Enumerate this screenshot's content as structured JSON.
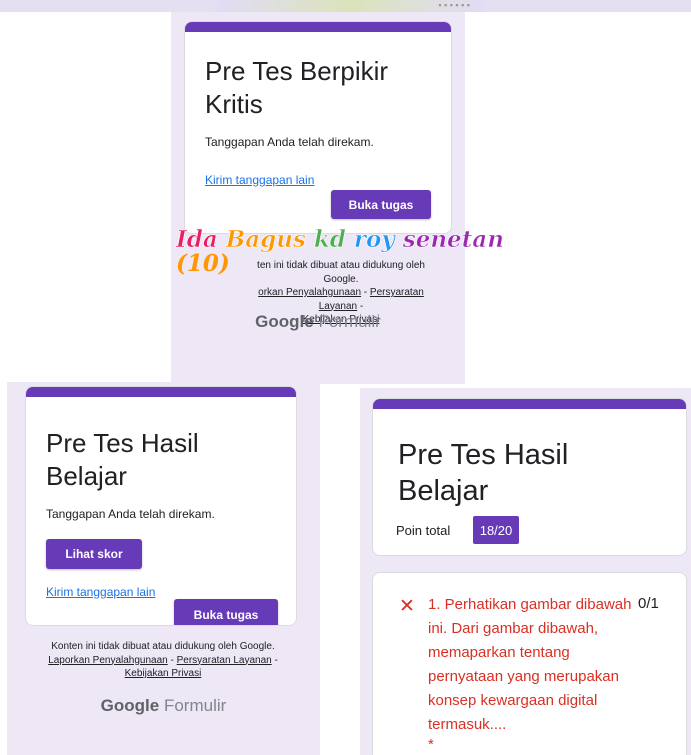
{
  "screens": [
    {
      "title": "Pre Tes Berpikir Kritis",
      "confirmation": "Tanggapan Anda telah direkam.",
      "submit_another_link": "Kirim tanggapan lain",
      "open_task_button": "Buka tugas",
      "footer": {
        "disclaimer_partial": "ten ini tidak dibuat atau didukung oleh Google.",
        "report_abuse_partial": "orkan Penyalahgunaan",
        "terms": "Persyaratan Layanan",
        "privacy": "Kebijakan Privasi"
      },
      "brand": {
        "google": "Google",
        "formulir": "Formulir"
      }
    },
    {
      "title": "Pre Tes Hasil Belajar",
      "confirmation": "Tanggapan Anda telah direkam.",
      "view_score_button": "Lihat skor",
      "submit_another_link": "Kirim tanggapan lain",
      "open_task_button": "Buka tugas",
      "footer": {
        "disclaimer": "Konten ini tidak dibuat atau didukung oleh Google.",
        "report_abuse": "Laporkan Penyalahgunaan",
        "terms": "Persyaratan Layanan",
        "privacy": "Kebijakan Privasi"
      },
      "brand": {
        "google": "Google",
        "formulir": "Formulir"
      }
    },
    {
      "title": "Pre Tes Hasil Belajar",
      "total_points_label": "Poin total",
      "total_points_value": "18/20",
      "question": {
        "text": "1. Perhatikan gambar dibawah ini. Dari gambar dibawah, memaparkan tentang pernyataan yang merupakan konsep kewargaan digital termasuk....",
        "points": "0/1",
        "required_marker": "*",
        "result_icon": "x-icon"
      }
    }
  ],
  "watermark": {
    "line1": "Ida Bagus kd roy senetan",
    "line2": "(10)"
  },
  "colors": {
    "accent": "#673ab7",
    "panel_bg": "#ede7f6",
    "link": "#1a73e8",
    "error": "#d93025"
  }
}
